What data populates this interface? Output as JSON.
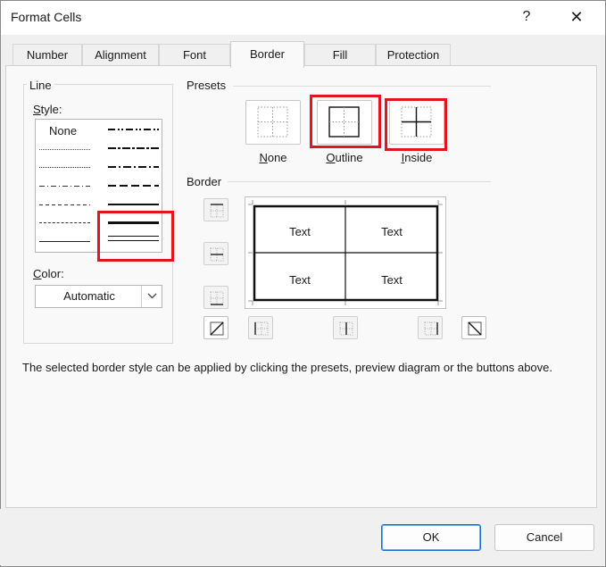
{
  "window": {
    "title": "Format Cells",
    "help_glyph": "?",
    "close_glyph": "✕"
  },
  "tabs": [
    {
      "label": "Number"
    },
    {
      "label": "Alignment"
    },
    {
      "label": "Font"
    },
    {
      "label": "Border",
      "active": true
    },
    {
      "label": "Fill"
    },
    {
      "label": "Protection"
    }
  ],
  "line": {
    "group_label": "Line",
    "style_label": "Style:",
    "none_label": "None",
    "color_label": "Color:",
    "color_value": "Automatic"
  },
  "presets": {
    "section_label": "Presets",
    "items": [
      {
        "label": "None"
      },
      {
        "label": "Outline"
      },
      {
        "label": "Inside"
      }
    ]
  },
  "border": {
    "section_label": "Border",
    "preview_cells": [
      "Text",
      "Text",
      "Text",
      "Text"
    ]
  },
  "hint_text": "The selected border style can be applied by clicking the presets, preview diagram or the buttons above.",
  "buttons": {
    "ok": "OK",
    "cancel": "Cancel"
  },
  "colors": {
    "highlight": "#e0161c",
    "primary_border": "#1a6dd6"
  }
}
